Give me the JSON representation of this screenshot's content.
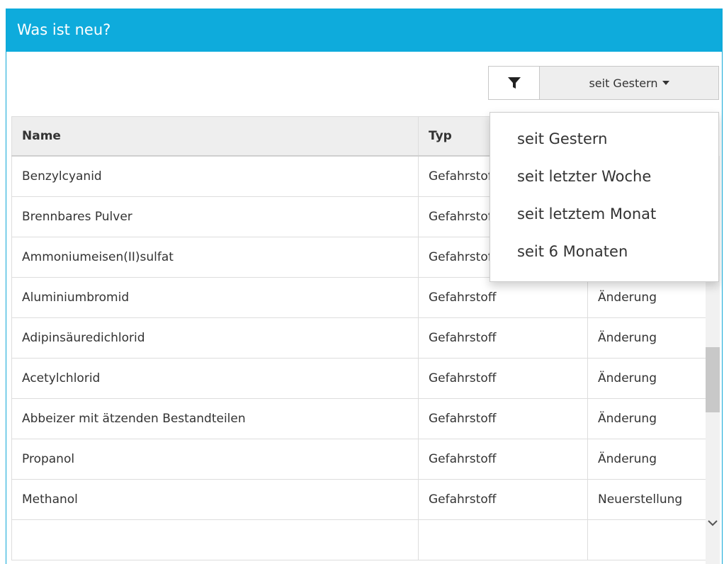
{
  "panel": {
    "title": "Was ist neu?"
  },
  "filter": {
    "icon": "filter-icon",
    "selected": "seit Gestern",
    "options": [
      "seit Gestern",
      "seit letzter Woche",
      "seit letztem Monat",
      "seit 6 Monaten"
    ]
  },
  "table": {
    "headers": [
      "Name",
      "Typ",
      ""
    ],
    "rows": [
      [
        "Benzylcyanid",
        "Gefahrstoff",
        ""
      ],
      [
        "Brennbares Pulver",
        "Gefahrstoff",
        ""
      ],
      [
        "Ammoniumeisen(II)sulfat",
        "Gefahrstoff",
        ""
      ],
      [
        "Aluminiumbromid",
        "Gefahrstoff",
        "Änderung"
      ],
      [
        "Adipinsäuredichlorid",
        "Gefahrstoff",
        "Änderung"
      ],
      [
        "Acetylchlorid",
        "Gefahrstoff",
        "Änderung"
      ],
      [
        "Abbeizer mit ätzenden Bestandteilen",
        "Gefahrstoff",
        "Änderung"
      ],
      [
        "Propanol",
        "Gefahrstoff",
        "Änderung"
      ],
      [
        "Methanol",
        "Gefahrstoff",
        "Neuerstellung"
      ],
      [
        "",
        "",
        ""
      ]
    ]
  },
  "colors": {
    "header_bg": "#0eabdc",
    "header_text": "#ffffff"
  }
}
